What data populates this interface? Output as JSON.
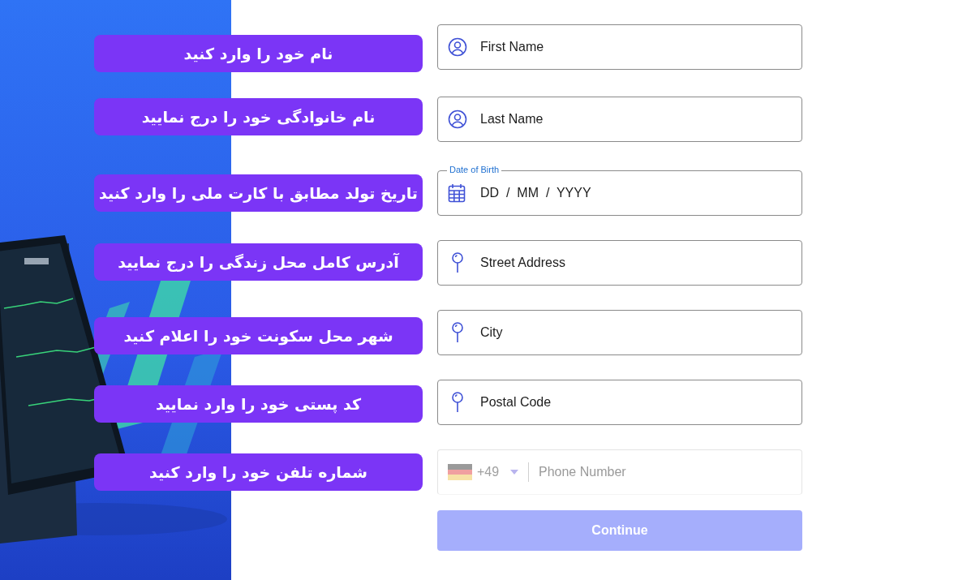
{
  "fields": [
    {
      "kind": "name",
      "placeholder": "First Name",
      "callout": "نام خود را وارد کنید"
    },
    {
      "kind": "name",
      "placeholder": "Last Name",
      "callout": "نام خانوادگی خود را درج نمایید"
    },
    {
      "kind": "date",
      "legend": "Date of Birth",
      "placeholder": "DD  /  MM  /  YYYY",
      "callout": "تاریخ تولد مطابق با کارت ملی را وارد کنید"
    },
    {
      "kind": "address",
      "placeholder": "Street Address",
      "callout": "آدرس کامل محل زندگی را درج نمایید"
    },
    {
      "kind": "address",
      "placeholder": "City",
      "callout": "شهر محل سکونت خود را اعلام کنید"
    },
    {
      "kind": "address",
      "placeholder": "Postal Code",
      "callout": "کد پستی خود را وارد نمایید"
    },
    {
      "kind": "phone",
      "country_code": "+49",
      "placeholder": "Phone Number",
      "callout": "شماره تلفن خود را وارد کنید"
    }
  ],
  "continue_button": {
    "label": "Continue",
    "disabled": true
  }
}
